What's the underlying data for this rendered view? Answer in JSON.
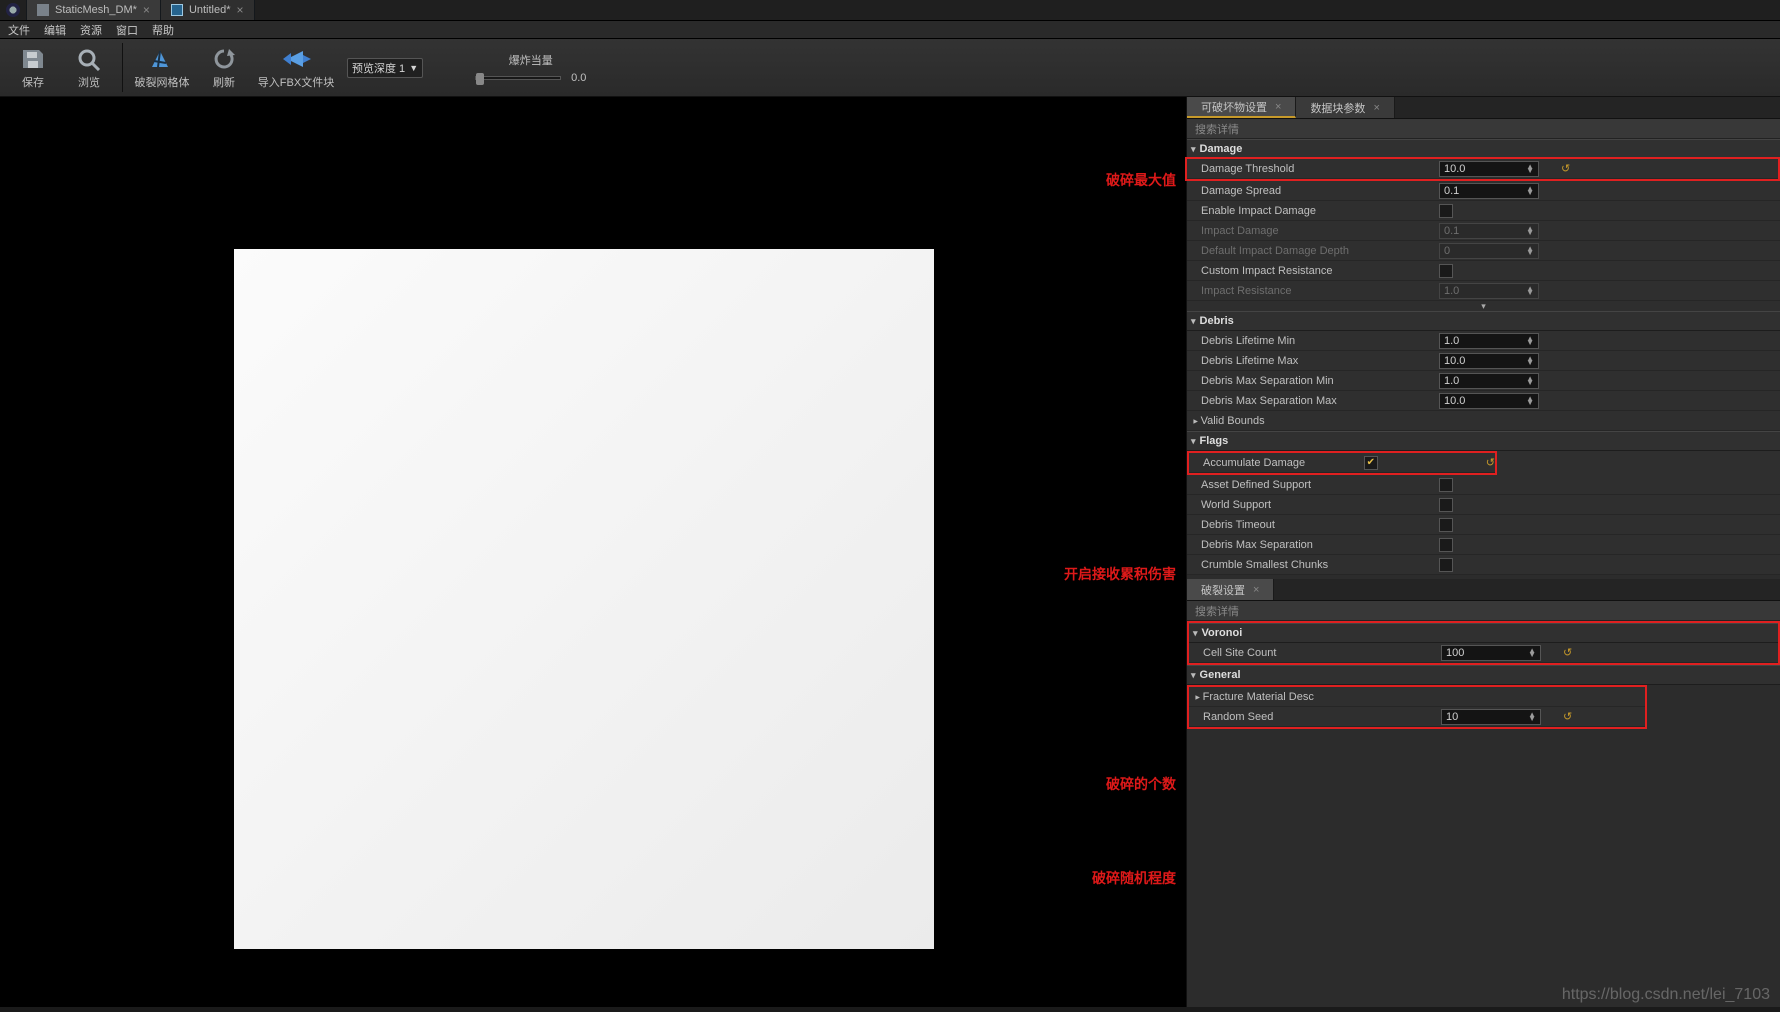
{
  "tabs": [
    {
      "label": "StaticMesh_DM*"
    },
    {
      "label": "Untitled*"
    }
  ],
  "menu": {
    "file": "文件",
    "edit": "编辑",
    "asset": "资源",
    "window": "窗口",
    "help": "帮助"
  },
  "toolbar": {
    "save": "保存",
    "browse": "浏览",
    "fracture": "破裂网格体",
    "refresh": "刷新",
    "importfbx": "导入FBX文件块",
    "previewDepth": "预览深度 1",
    "explodeLabel": "爆炸当量",
    "explodeVal": "0.0"
  },
  "panelTabs": {
    "destructible": "可破坏物设置",
    "chunkParams": "数据块参数",
    "fracture": "破裂设置"
  },
  "search": "搜索详情",
  "sections": {
    "damage": "Damage",
    "debris": "Debris",
    "flags": "Flags",
    "voronoi": "Voronoi",
    "general": "General",
    "validBounds": "Valid Bounds",
    "fractureMat": "Fracture Material Desc"
  },
  "props": {
    "damageThreshold": {
      "label": "Damage Threshold",
      "val": "10.0"
    },
    "damageSpread": {
      "label": "Damage Spread",
      "val": "0.1"
    },
    "enableImpact": {
      "label": "Enable Impact Damage"
    },
    "impactDamage": {
      "label": "Impact Damage",
      "val": "0.1"
    },
    "defaultImpactDepth": {
      "label": "Default Impact Damage Depth",
      "val": "0"
    },
    "customImpactRes": {
      "label": "Custom Impact Resistance"
    },
    "impactRes": {
      "label": "Impact Resistance",
      "val": "1.0"
    },
    "debrisMin": {
      "label": "Debris Lifetime Min",
      "val": "1.0"
    },
    "debrisMax": {
      "label": "Debris Lifetime Max",
      "val": "10.0"
    },
    "debrisSepMin": {
      "label": "Debris Max Separation Min",
      "val": "1.0"
    },
    "debrisSepMax": {
      "label": "Debris Max Separation Max",
      "val": "10.0"
    },
    "accumDamage": {
      "label": "Accumulate Damage"
    },
    "assetDefSupport": {
      "label": "Asset Defined Support"
    },
    "worldSupport": {
      "label": "World Support"
    },
    "debrisTimeout": {
      "label": "Debris Timeout"
    },
    "debrisMaxSep": {
      "label": "Debris Max Separation"
    },
    "crumble": {
      "label": "Crumble Smallest Chunks"
    },
    "cellSite": {
      "label": "Cell Site Count",
      "val": "100"
    },
    "randomSeed": {
      "label": "Random Seed",
      "val": "10"
    }
  },
  "annotations": {
    "dmgMax": "破碎最大值",
    "accum": "开启接收累积伤害",
    "count": "破碎的个数",
    "seed": "破碎随机程度"
  },
  "watermark": "https://blog.csdn.net/lei_7103"
}
